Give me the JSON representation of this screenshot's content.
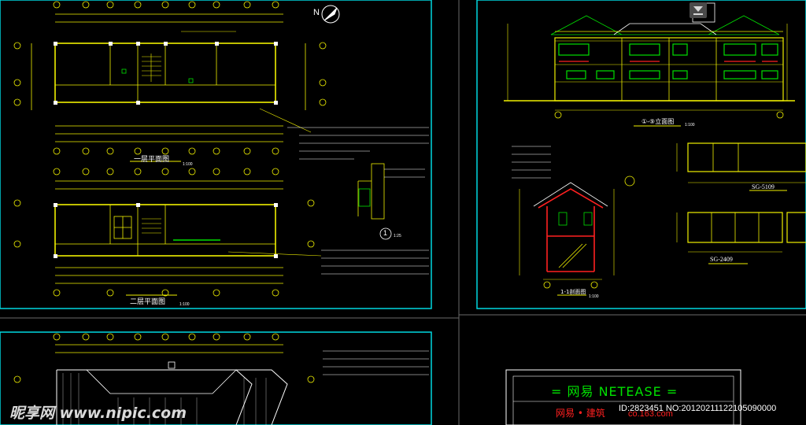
{
  "sheet_labels": {
    "floor1_title": "一层平面图",
    "floor2_title": "二层平面图",
    "scale": "1:100",
    "elevation_title": "①-⑨立面图",
    "section_title": "1-1剖面图",
    "window_label_1": "SG-5109",
    "window_label_2": "SG-2409",
    "detail_marker": "1",
    "detail_scale": "1:25",
    "north_marker": "N"
  },
  "title_block": {
    "brand": "= 网易 NETEASE =",
    "subtitle": "网易 • 建筑",
    "url": "co.163.com"
  },
  "watermark": {
    "logo": "昵享网 www.nipic.com",
    "id_line": "ID:2823451 NO:20120211122105090000"
  },
  "colors": {
    "background": "#000000",
    "frame": "#00d8e0",
    "linework": "#f0f000",
    "wall": "#ff2020",
    "fill_green": "#00e000",
    "text": "#ffffff"
  },
  "icons": [
    "north-arrow-icon",
    "download-icon"
  ]
}
